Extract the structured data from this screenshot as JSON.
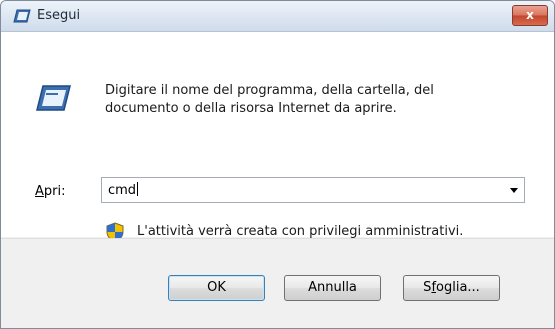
{
  "window": {
    "title": "Esegui",
    "close_label": "x"
  },
  "dialog": {
    "description": "Digitare il nome del programma, della cartella, del documento o della risorsa Internet da aprire.",
    "open_label_accel": "A",
    "open_label_rest": "pri:",
    "command_value": "cmd",
    "admin_notice": "L'attività verrà creata con privilegi amministrativi."
  },
  "buttons": {
    "ok": "OK",
    "cancel": "Annulla",
    "browse_pre": "S",
    "browse_accel": "f",
    "browse_post": "oglia..."
  },
  "icons": {
    "title": "run-window-icon",
    "main": "run-window-icon",
    "close": "close-icon",
    "dropdown": "chevron-down-icon",
    "admin": "uac-shield-icon"
  },
  "colors": {
    "close_button": "#c1462d",
    "titlebar": "#dfe8f3",
    "default_button_border": "#3c7fb1"
  }
}
